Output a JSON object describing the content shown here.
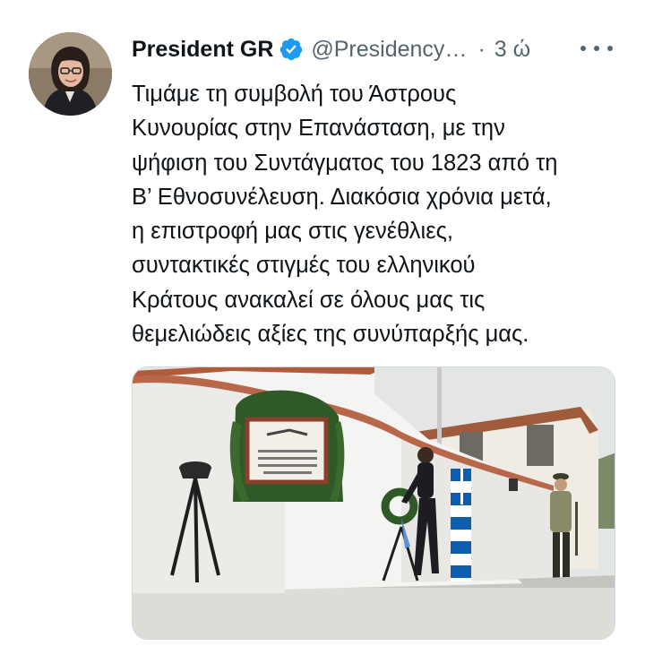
{
  "tweet": {
    "author": {
      "display_name": "President GR",
      "handle": "@Presidency…",
      "verified": true
    },
    "separator": "·",
    "time": "3 ώ",
    "text_lines": [
      "Τιμάμε τη συμβολή του Άστρους",
      "Κυνουρίας στην Επανάσταση, με την",
      "ψήφιση του Συντάγματος του 1823 από τη",
      "Β’ Εθνοσυνέλευση. Διακόσια χρόνια μετά,",
      "η επιστροφή μας στις γενέθλιες,",
      "συντακτικές στιγμές του ελληνικού",
      "Κράτους ανακαλεί σε όλους μας τις",
      "θεμελιώδεις αξίες της συνύπαρξής μας."
    ]
  },
  "colors": {
    "text_primary": "#0f1419",
    "text_secondary": "#536471",
    "verified_blue": "#1d9bf0",
    "greek_flag_blue": "#0d5eaf"
  },
  "icons": {
    "verified": "verified-badge-icon",
    "more": "more-horizontal-icon"
  }
}
